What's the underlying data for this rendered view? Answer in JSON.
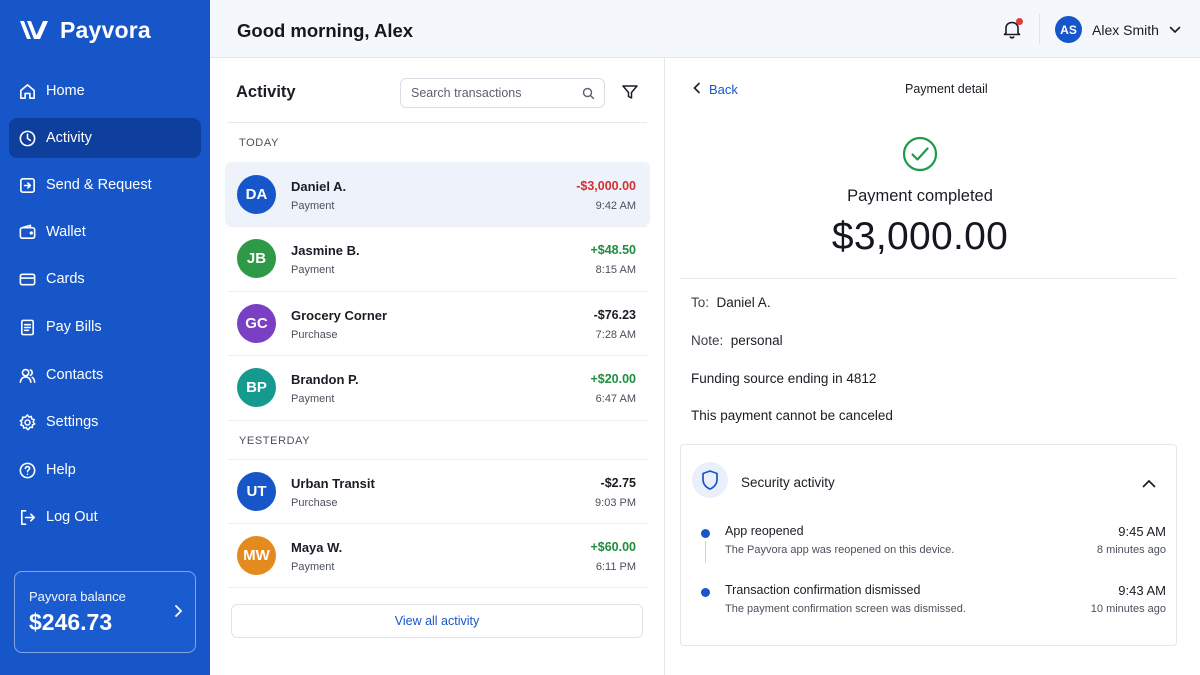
{
  "brand": {
    "name": "Payvora"
  },
  "sidebar": {
    "items": [
      {
        "label": "Home",
        "icon": "home-icon",
        "active": false
      },
      {
        "label": "Activity",
        "icon": "clock-icon",
        "active": true
      },
      {
        "label": "Send & Request",
        "icon": "send-request-icon",
        "active": false
      },
      {
        "label": "Wallet",
        "icon": "wallet-icon",
        "active": false
      },
      {
        "label": "Cards",
        "icon": "card-icon",
        "active": false
      },
      {
        "label": "Pay Bills",
        "icon": "bill-icon",
        "active": false
      },
      {
        "label": "Contacts",
        "icon": "contacts-icon",
        "active": false
      },
      {
        "label": "Settings",
        "icon": "gear-icon",
        "active": false
      },
      {
        "label": "Help",
        "icon": "help-icon",
        "active": false
      },
      {
        "label": "Log Out",
        "icon": "logout-icon",
        "active": false
      }
    ],
    "balance": {
      "label": "Payvora balance",
      "value": "$246.73"
    }
  },
  "header": {
    "greeting": "Good morning, Alex",
    "user": {
      "initials": "AS",
      "name": "Alex Smith"
    },
    "notification_dot_color": "#e23b3b"
  },
  "activity": {
    "title": "Activity",
    "search_placeholder": "Search transactions",
    "sections": [
      {
        "label": "TODAY",
        "transactions": [
          {
            "initials": "DA",
            "name": "Daniel A.",
            "type": "Payment",
            "amount": "-$3,000.00",
            "time": "9:42 AM",
            "avatar_color": "#1756c9",
            "amount_style": "negative-red",
            "selected": true
          },
          {
            "initials": "JB",
            "name": "Jasmine B.",
            "type": "Payment",
            "amount": "+$48.50",
            "time": "8:15 AM",
            "avatar_color": "#2e9a48",
            "amount_style": "positive",
            "selected": false
          },
          {
            "initials": "GC",
            "name": "Grocery Corner",
            "type": "Purchase",
            "amount": "-$76.23",
            "time": "7:28 AM",
            "avatar_color": "#7a3fc2",
            "amount_style": "negative",
            "selected": false
          },
          {
            "initials": "BP",
            "name": "Brandon P.",
            "type": "Payment",
            "amount": "+$20.00",
            "time": "6:47 AM",
            "avatar_color": "#16998f",
            "amount_style": "positive",
            "selected": false
          }
        ]
      },
      {
        "label": "YESTERDAY",
        "transactions": [
          {
            "initials": "UT",
            "name": "Urban Transit",
            "type": "Purchase",
            "amount": "-$2.75",
            "time": "9:03 PM",
            "avatar_color": "#1756c9",
            "amount_style": "negative",
            "selected": false
          },
          {
            "initials": "MW",
            "name": "Maya W.",
            "type": "Payment",
            "amount": "+$60.00",
            "time": "6:11 PM",
            "avatar_color": "#e58a1f",
            "amount_style": "positive",
            "selected": false
          }
        ]
      }
    ],
    "view_all_label": "View all activity"
  },
  "detail": {
    "back_label": "Back",
    "title": "Payment detail",
    "status": "Payment completed",
    "amount_symbol": "$",
    "amount_value": "3,000.00",
    "to_label": "To:",
    "to_value": "Daniel A.",
    "note_label": "Note:",
    "note_value": "personal",
    "funding": "Funding source ending in 4812",
    "cancel_notice": "This payment cannot be canceled",
    "security": {
      "title": "Security activity",
      "events": [
        {
          "title": "App reopened",
          "desc": "The Payvora app was reopened on this device.",
          "time": "9:45 AM",
          "ago": "8 minutes ago"
        },
        {
          "title": "Transaction confirmation dismissed",
          "desc": "The payment confirmation screen was dismissed.",
          "time": "9:43 AM",
          "ago": "10 minutes ago"
        }
      ]
    }
  },
  "colors": {
    "brand_blue": "#1756c9",
    "active_nav": "#0f3f9c",
    "positive": "#1e8e3e",
    "negative_red": "#d32f2f",
    "success_check": "#1e9a4a"
  }
}
